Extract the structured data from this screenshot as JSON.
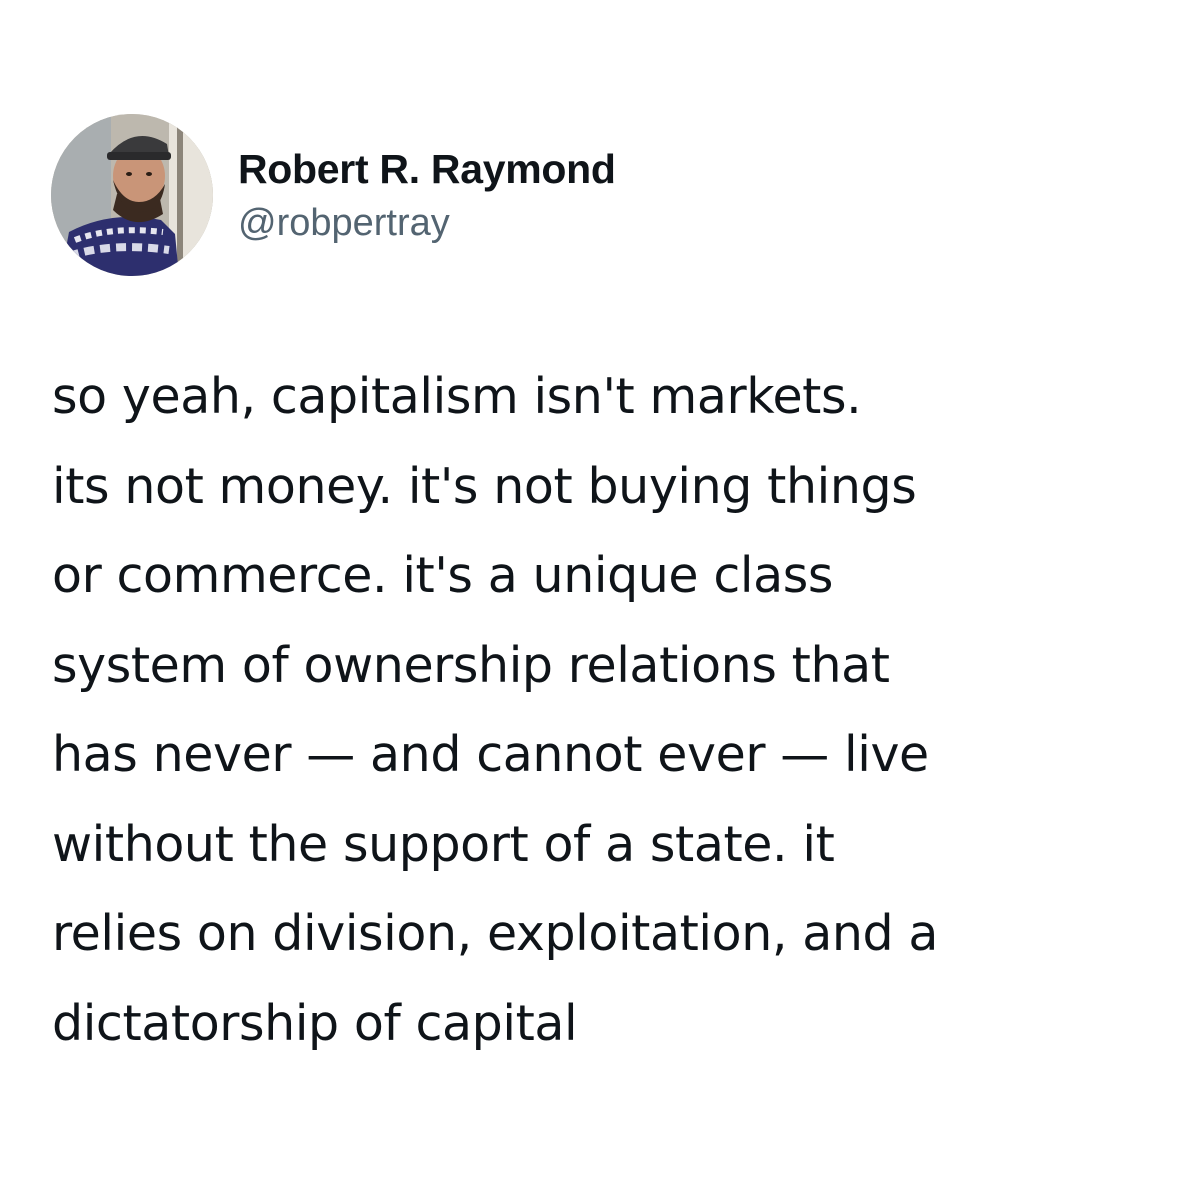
{
  "author": {
    "display_name": "Robert R. Raymond",
    "handle": "@robpertray",
    "avatar_icon": "profile-photo-icon"
  },
  "tweet": {
    "lines": [
      "so yeah, capitalism isn't markets.",
      "its not money. it's not buying things",
      "or commerce. it's a unique class",
      "system of ownership relations that",
      "has never — and cannot ever — live",
      "without the support of a state. it",
      "relies on division, exploitation, and a",
      "dictatorship of capital"
    ]
  },
  "colors": {
    "text": "#0f1419",
    "secondary_text": "#536471",
    "background": "#ffffff"
  }
}
